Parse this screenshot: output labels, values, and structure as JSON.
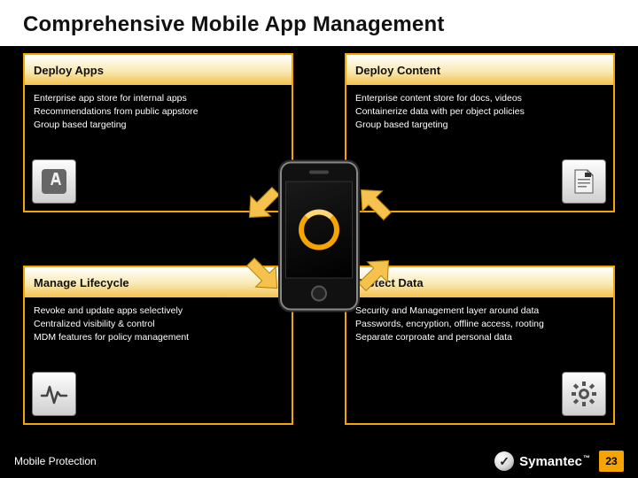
{
  "title": "Comprehensive Mobile App Management",
  "panels": {
    "tl": {
      "heading": "Deploy Apps",
      "line1": "Enterprise app store for internal apps",
      "line2": "Recommendations from public appstore",
      "line3": "Group based targeting",
      "icon": "appstore-icon"
    },
    "tr": {
      "heading": "Deploy Content",
      "line1": "Enterprise content store for docs, videos",
      "line2": "Containerize data with per object policies",
      "line3": "Group based targeting",
      "icon": "document-icon"
    },
    "bl": {
      "heading": "Manage Lifecycle",
      "line1": "Revoke and update apps selectively",
      "line2": "Centralized visibility & control",
      "line3": "MDM features for policy management",
      "icon": "pulse-icon"
    },
    "br": {
      "heading": "Protect Data",
      "line1": "Security and Management layer around data",
      "line2": "Passwords, encryption, offline access, rooting",
      "line3": "Separate corproate and personal data",
      "icon": "gear-icon"
    }
  },
  "footer": {
    "left": "Mobile Protection",
    "brand": "Symantec",
    "tm": "™",
    "page": "23"
  },
  "colors": {
    "accent": "#f5a400"
  }
}
